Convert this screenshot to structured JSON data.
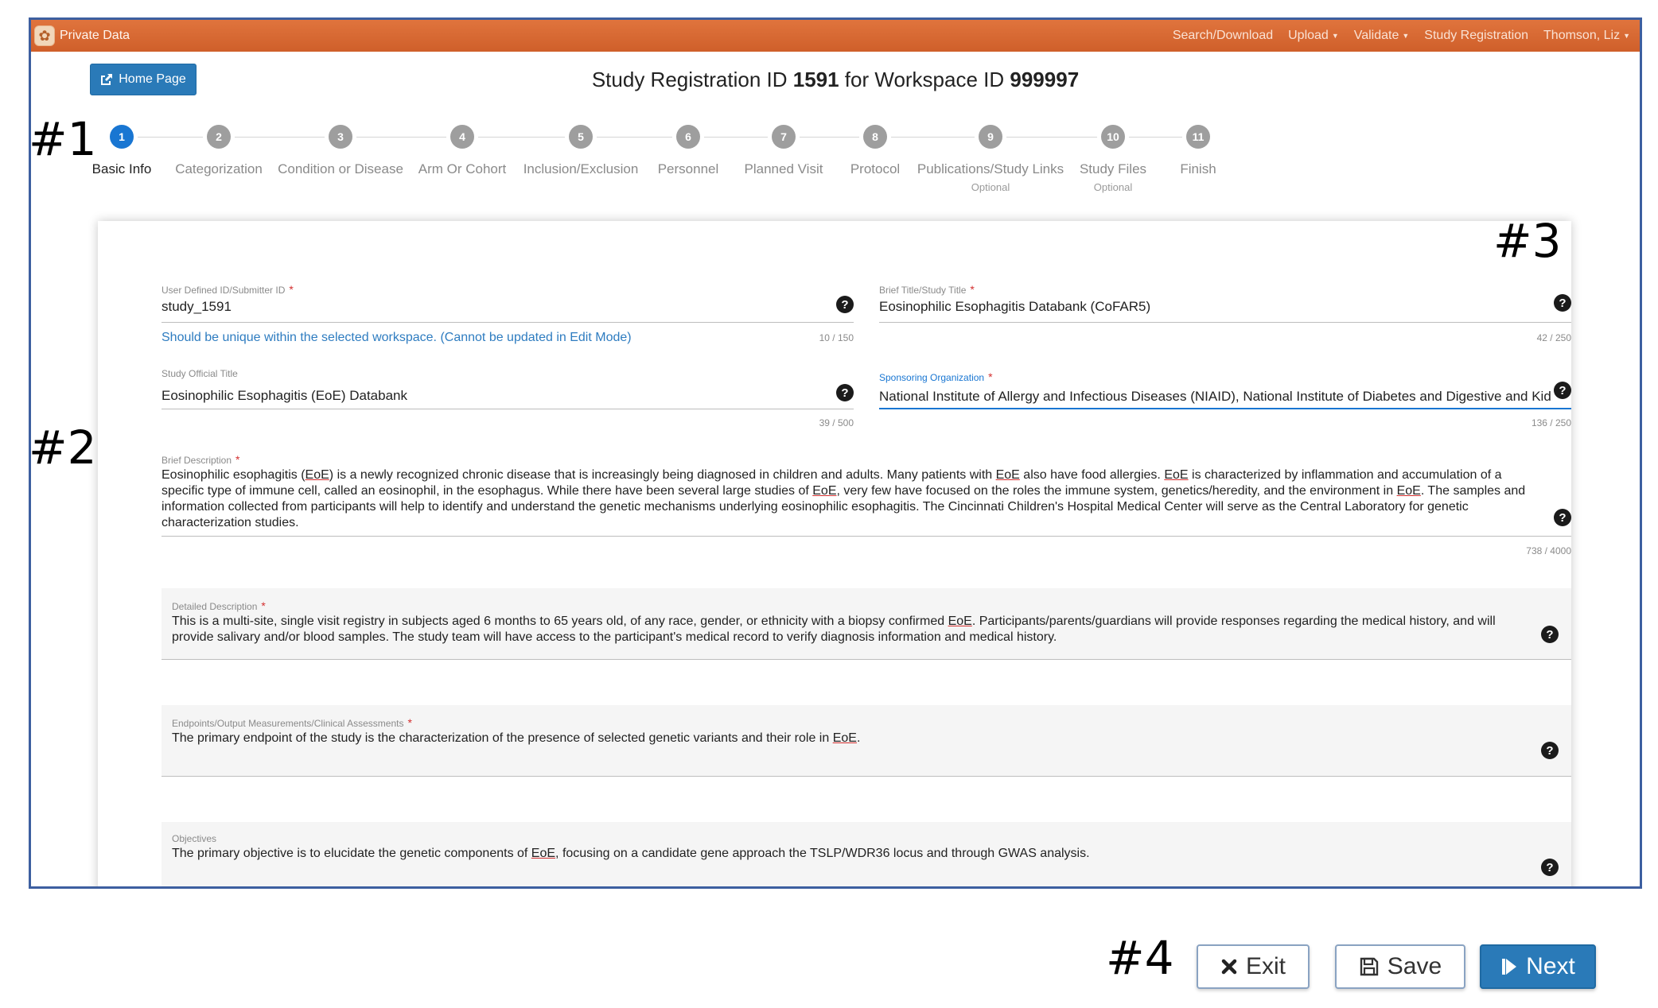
{
  "nav": {
    "brand": "Private Data",
    "items": [
      {
        "label": "Search/Download",
        "caret": false
      },
      {
        "label": "Upload",
        "caret": true
      },
      {
        "label": "Validate",
        "caret": true
      },
      {
        "label": "Study Registration",
        "caret": false
      },
      {
        "label": "Thomson, Liz",
        "caret": true
      }
    ]
  },
  "home_button": {
    "label": "Home Page",
    "icon": "external-link-icon"
  },
  "title": {
    "prefix": "Study Registration ID ",
    "study_id": "1591",
    "middle": " for Workspace ID ",
    "workspace_id": "999997"
  },
  "steps": [
    {
      "num": "1",
      "label": "Basic Info",
      "sub": "",
      "active": true
    },
    {
      "num": "2",
      "label": "Categorization",
      "sub": ""
    },
    {
      "num": "3",
      "label": "Condition or Disease",
      "sub": ""
    },
    {
      "num": "4",
      "label": "Arm Or Cohort",
      "sub": ""
    },
    {
      "num": "5",
      "label": "Inclusion/Exclusion",
      "sub": ""
    },
    {
      "num": "6",
      "label": "Personnel",
      "sub": ""
    },
    {
      "num": "7",
      "label": "Planned Visit",
      "sub": ""
    },
    {
      "num": "8",
      "label": "Protocol",
      "sub": ""
    },
    {
      "num": "9",
      "label": "Publications/Study Links",
      "sub": "Optional"
    },
    {
      "num": "10",
      "label": "Study Files",
      "sub": "Optional"
    },
    {
      "num": "11",
      "label": "Finish",
      "sub": ""
    }
  ],
  "fields": {
    "submitter_id": {
      "label": "User Defined ID/Submitter ID",
      "value": "study_1591",
      "counter": "10 / 150",
      "hint": "Should be unique within the selected workspace. (Cannot be updated in Edit Mode)"
    },
    "brief_title": {
      "label": "Brief Title/Study Title",
      "value": "Eosinophilic Esophagitis Databank (CoFAR5)",
      "counter": "42 / 250"
    },
    "official_title": {
      "label": "Study Official Title",
      "value": "Eosinophilic Esophagitis (EoE) Databank",
      "counter": "39 / 500"
    },
    "sponsor": {
      "label": "Sponsoring Organization",
      "value": "National Institute of Allergy and Infectious Diseases (NIAID), National Institute of Diabetes and Digestive and Kidney",
      "counter": "136 / 250"
    },
    "brief_description": {
      "label": "Brief Description",
      "parts": [
        "Eosinophilic esophagitis (",
        "EoE",
        ") is a newly recognized chronic disease that is increasingly being diagnosed in children and adults. Many patients with ",
        "EoE",
        " also have food allergies. ",
        "EoE",
        " is characterized by inflammation and accumulation of a specific type of immune cell, called an eosinophil, in the esophagus. While there have been several large studies of ",
        "EoE",
        ", very few have focused on the roles the immune system, genetics/heredity, and the environment in ",
        "EoE",
        ". The samples and information collected from participants will help to identify and understand the genetic mechanisms underlying eosinophilic esophagitis. The Cincinnati Children's Hospital Medical Center will serve as the Central Laboratory for genetic characterization studies."
      ],
      "counter": "738 / 4000"
    },
    "detailed_description": {
      "label": "Detailed Description",
      "parts": [
        "This is a multi-site, single visit registry in subjects aged 6 months to 65 years old, of any race, gender, or ethnicity with a biopsy confirmed ",
        "EoE",
        ". Participants/parents/guardians will provide responses regarding the medical history, and will provide salivary and/or blood samples. The study team will have access to the participant's medical record to verify diagnosis information and medical history."
      ]
    },
    "endpoints": {
      "label": "Endpoints/Output Measurements/Clinical Assessments",
      "parts": [
        "The primary endpoint of the study is the characterization of the presence of selected genetic variants and their role in ",
        "EoE",
        "."
      ]
    },
    "objectives": {
      "label": "Objectives",
      "parts": [
        "The primary objective is to elucidate the genetic components of ",
        "EoE",
        ", focusing on a candidate gene approach the TSLP/WDR36 locus and through GWAS analysis."
      ]
    }
  },
  "annotations": {
    "a1": "#1",
    "a2": "#2",
    "a3": "#3",
    "a4": "#4"
  },
  "buttons": {
    "exit": {
      "label": "Exit",
      "icon": "close-icon"
    },
    "save": {
      "label": "Save",
      "icon": "floppy-disk-icon"
    },
    "next": {
      "label": "Next",
      "icon": "step-forward-icon"
    }
  },
  "colors": {
    "nav_orange": "#d8652f",
    "primary_blue": "#2a7ab8",
    "step_active": "#1976d2",
    "frame_blue": "#3d5fa0",
    "required_red": "#d32f2f"
  }
}
